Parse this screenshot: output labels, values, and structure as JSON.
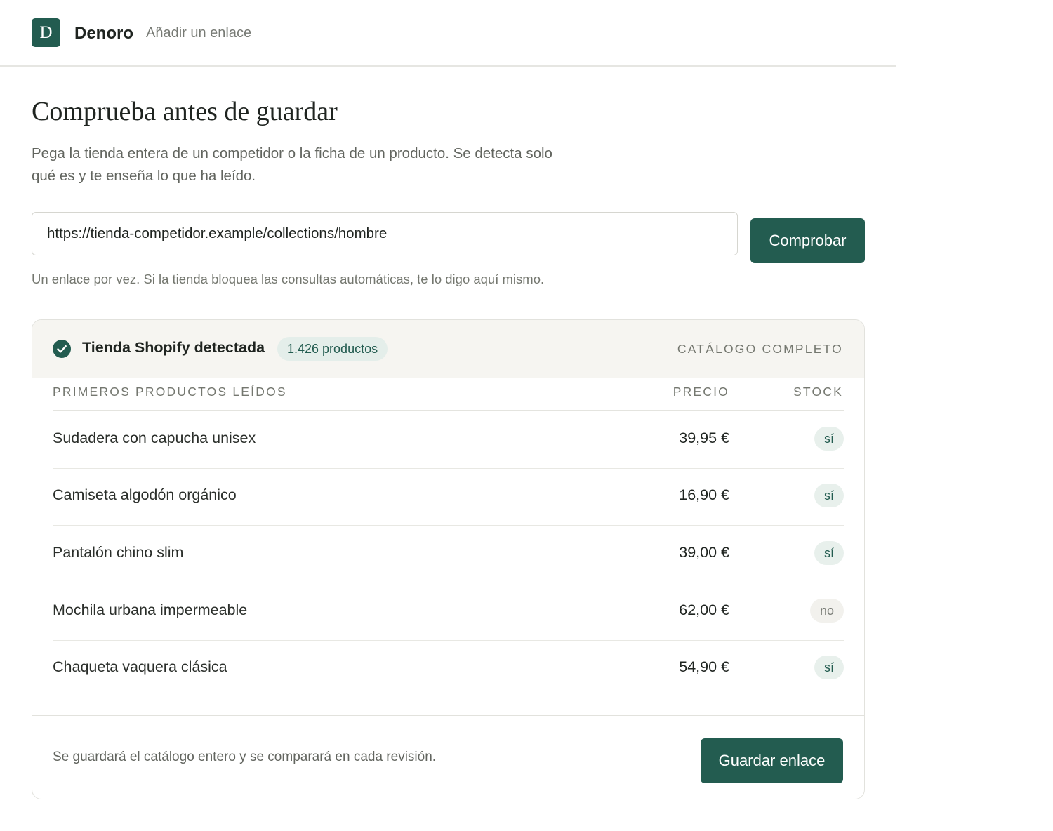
{
  "header": {
    "logo_letter": "D",
    "brand": "Denoro",
    "crumb": "Añadir un enlace"
  },
  "main": {
    "title": "Comprueba antes de guardar",
    "intro": "Pega la tienda entera de un competidor o la ficha de un producto. Se detecta solo qué es y te enseña lo que ha leído.",
    "url_value": "https://tienda-competidor.example/collections/hombre",
    "check_label": "Comprobar",
    "hint": "Un enlace por vez. Si la tienda bloquea las consultas automáticas, te lo digo aquí mismo."
  },
  "result": {
    "detected": "Tienda Shopify detectada",
    "count": "1.426 productos",
    "scope": "CATÁLOGO COMPLETO",
    "columns": {
      "name": "PRIMEROS PRODUCTOS LEÍDOS",
      "price": "PRECIO",
      "stock": "STOCK"
    },
    "rows": [
      {
        "name": "Sudadera con capucha unisex",
        "price": "39,95 €",
        "stock": "sí",
        "in_stock": true
      },
      {
        "name": "Camiseta algodón orgánico",
        "price": "16,90 €",
        "stock": "sí",
        "in_stock": true
      },
      {
        "name": "Pantalón chino slim",
        "price": "39,00 €",
        "stock": "sí",
        "in_stock": true
      },
      {
        "name": "Mochila urbana impermeable",
        "price": "62,00 €",
        "stock": "no",
        "in_stock": false
      },
      {
        "name": "Chaqueta vaquera clásica",
        "price": "54,90 €",
        "stock": "sí",
        "in_stock": true
      }
    ],
    "footer_note": "Se guardará el catálogo entero y se comparará en cada revisión.",
    "save_label": "Guardar enlace"
  },
  "colors": {
    "accent": "#235c50",
    "badge_bg": "#e4eeea",
    "header_bg": "#f6f5f1"
  },
  "icons": {
    "detected": "check-circle-icon"
  }
}
